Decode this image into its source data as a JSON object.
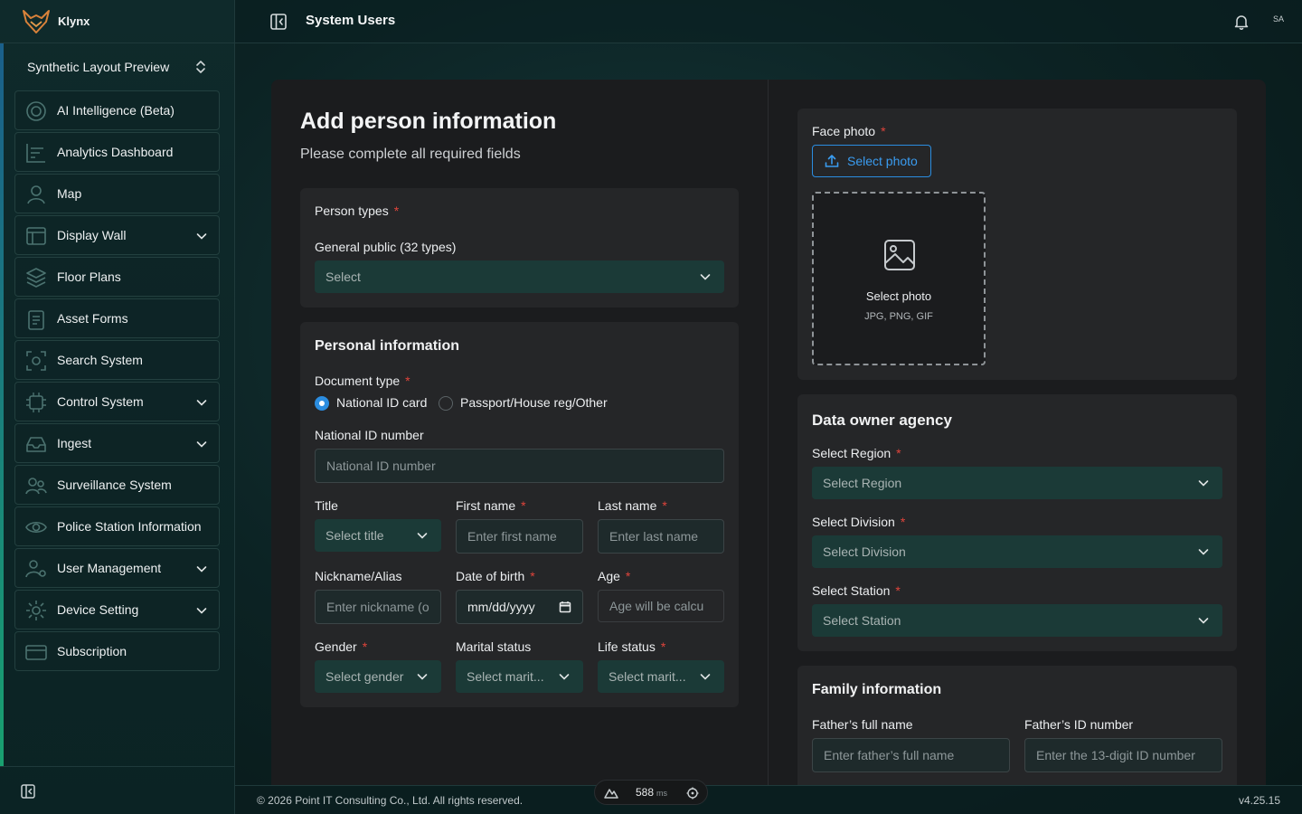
{
  "brand": {
    "name": "Klynx"
  },
  "workspace": {
    "label": "Synthetic Layout Preview"
  },
  "sidebar": {
    "items": [
      {
        "label": "AI Intelligence (Beta)",
        "icon": "target-icon",
        "expandable": false
      },
      {
        "label": "Analytics Dashboard",
        "icon": "chart-icon",
        "expandable": false
      },
      {
        "label": "Map",
        "icon": "map-pin-icon",
        "expandable": false
      },
      {
        "label": "Display Wall",
        "icon": "monitor-icon",
        "expandable": true
      },
      {
        "label": "Floor Plans",
        "icon": "layers-icon",
        "expandable": false
      },
      {
        "label": "Asset Forms",
        "icon": "clipboard-icon",
        "expandable": false
      },
      {
        "label": "Search System",
        "icon": "face-scan-icon",
        "expandable": false
      },
      {
        "label": "Control System",
        "icon": "chip-icon",
        "expandable": true
      },
      {
        "label": "Ingest",
        "icon": "inbox-icon",
        "expandable": true
      },
      {
        "label": "Surveillance System",
        "icon": "users-icon",
        "expandable": false
      },
      {
        "label": "Police Station Information",
        "icon": "eye-icon",
        "expandable": false
      },
      {
        "label": "User Management",
        "icon": "users-gear-icon",
        "expandable": true
      },
      {
        "label": "Device Setting",
        "icon": "gear-icon",
        "expandable": true
      },
      {
        "label": "Subscription",
        "icon": "card-icon",
        "expandable": false
      }
    ]
  },
  "header": {
    "title": "System Users",
    "avatar": "SA"
  },
  "form": {
    "title": "Add person information",
    "subtitle": "Please complete all required fields",
    "person_types": {
      "label": "Person types",
      "group_label": "General public (32 types)",
      "select_value": "Select"
    },
    "personal": {
      "title": "Personal information",
      "document_type_label": "Document type",
      "options": [
        "National ID card",
        "Passport/House reg/Other"
      ],
      "selected_option": "National ID card",
      "national_id_label": "National ID number",
      "national_id_placeholder": "National ID number",
      "title_label": "Title",
      "title_select": "Select title",
      "first_name_label": "First name",
      "first_name_placeholder": "Enter first name",
      "last_name_label": "Last name",
      "last_name_placeholder": "Enter last name",
      "nickname_label": "Nickname/Alias",
      "nickname_placeholder": "Enter nickname (o",
      "dob_label": "Date of birth",
      "dob_placeholder": "mm/dd/yyyy",
      "age_label": "Age",
      "age_placeholder": "Age will be calcu",
      "gender_label": "Gender",
      "gender_select": "Select gender",
      "marital_label": "Marital status",
      "marital_select": "Select marit...",
      "life_label": "Life status",
      "life_select": "Select marit..."
    },
    "face_photo": {
      "label": "Face photo",
      "button": "Select photo",
      "drop_title": "Select photo",
      "drop_hint": "JPG, PNG, GIF"
    },
    "agency": {
      "title": "Data owner agency",
      "region_label": "Select Region",
      "region_select": "Select Region",
      "division_label": "Select Division",
      "division_select": "Select Division",
      "station_label": "Select Station",
      "station_select": "Select Station"
    },
    "family": {
      "title": "Family information",
      "father_name_label": "Father’s full name",
      "father_name_placeholder": "Enter father’s full name",
      "father_id_label": "Father’s ID number",
      "father_id_placeholder": "Enter the 13-digit ID number"
    }
  },
  "footer": {
    "copyright": "© 2026 Point IT Consulting Co., Ltd. All rights reserved.",
    "version": "v4.25.15",
    "perf_value": "588",
    "perf_unit": "ms"
  },
  "colors": {
    "accent_blue": "#2b8de0",
    "required_red": "#e0443b",
    "select_bg": "#1b3a37",
    "card_bg": "#1b1c1e",
    "panel_bg": "#252628"
  }
}
